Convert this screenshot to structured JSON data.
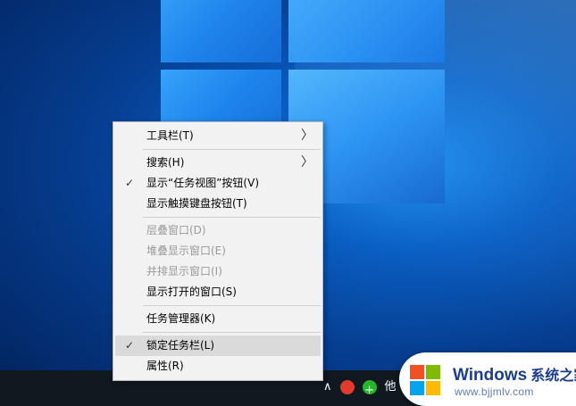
{
  "desktop": {
    "taskbar": {
      "tray_chevron": "∧",
      "tray_text": "他"
    }
  },
  "watermark": {
    "brand": "Windows",
    "brand_cn": "系统之家",
    "url": "www.bjjmlv.com"
  },
  "context_menu": {
    "items": [
      {
        "label": "工具栏(T)",
        "checked": false,
        "submenu": true,
        "disabled": false
      },
      {
        "label": "搜索(H)",
        "checked": false,
        "submenu": true,
        "disabled": false
      },
      {
        "label": "显示“任务视图”按钮(V)",
        "checked": true,
        "submenu": false,
        "disabled": false
      },
      {
        "label": "显示触摸键盘按钮(T)",
        "checked": false,
        "submenu": false,
        "disabled": false
      },
      {
        "label": "层叠窗口(D)",
        "checked": false,
        "submenu": false,
        "disabled": true
      },
      {
        "label": "堆叠显示窗口(E)",
        "checked": false,
        "submenu": false,
        "disabled": true
      },
      {
        "label": "并排显示窗口(I)",
        "checked": false,
        "submenu": false,
        "disabled": true
      },
      {
        "label": "显示打开的窗口(S)",
        "checked": false,
        "submenu": false,
        "disabled": false
      },
      {
        "label": "任务管理器(K)",
        "checked": false,
        "submenu": false,
        "disabled": false
      },
      {
        "label": "锁定任务栏(L)",
        "checked": true,
        "submenu": false,
        "disabled": false
      },
      {
        "label": "属性(R)",
        "checked": false,
        "submenu": false,
        "disabled": false
      }
    ],
    "check_glyph": "✓",
    "submenu_glyph": "〉"
  },
  "colors": {
    "menu_bg": "#f2f2f2",
    "menu_highlight": "#dadada",
    "disabled_text": "#9a9a9a",
    "desktop_blue": "#0a5fc4"
  }
}
